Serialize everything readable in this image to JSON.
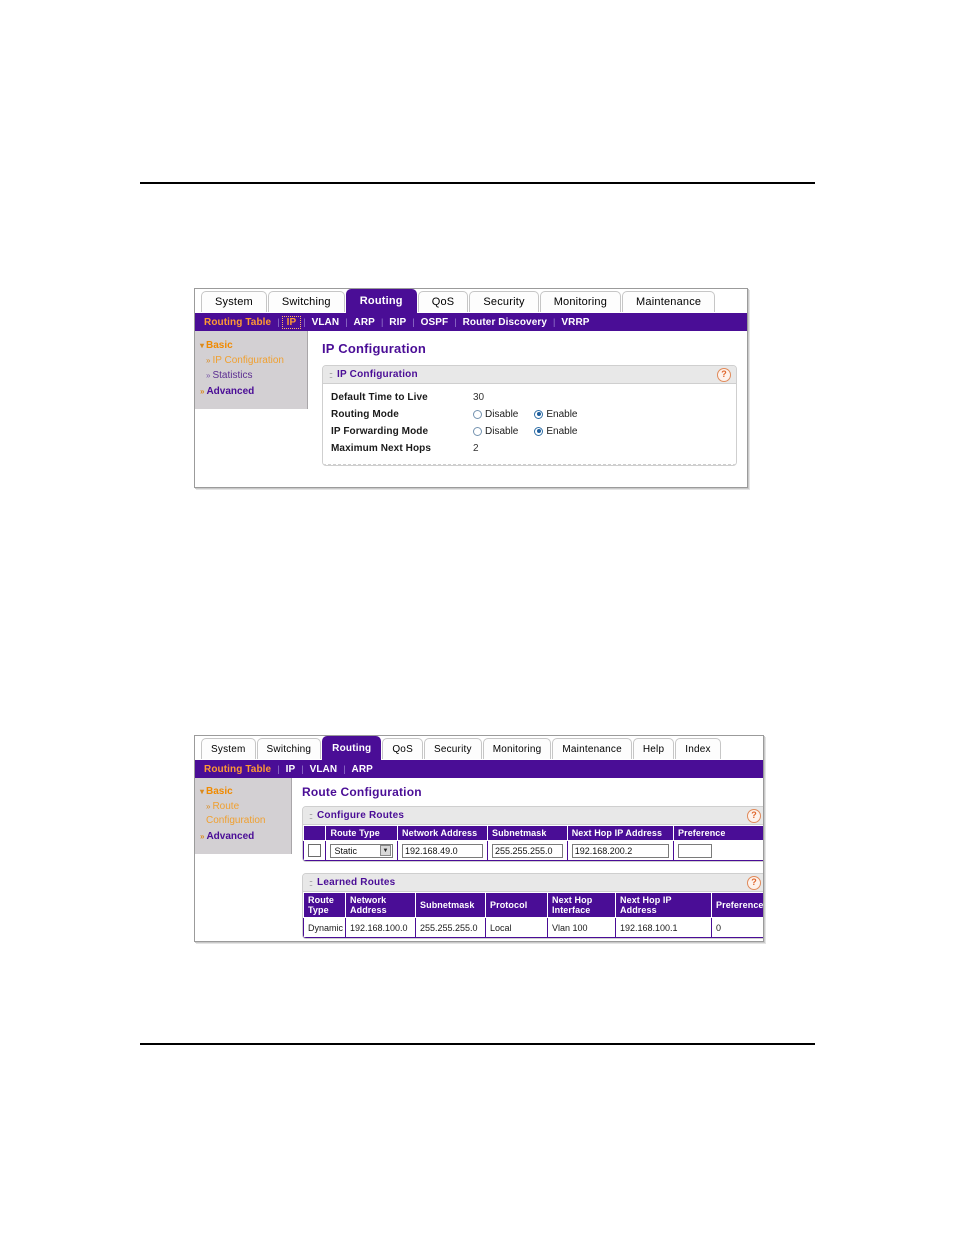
{
  "page": {
    "rules": [
      "top-rule",
      "bottom-rule"
    ]
  },
  "ip_screenshot": {
    "tabs": [
      {
        "label": "System",
        "active": false
      },
      {
        "label": "Switching",
        "active": false
      },
      {
        "label": "Routing",
        "active": true
      },
      {
        "label": "QoS",
        "active": false
      },
      {
        "label": "Security",
        "active": false
      },
      {
        "label": "Monitoring",
        "active": false
      },
      {
        "label": "Maintenance",
        "active": false
      }
    ],
    "subnav": [
      {
        "label": "Routing Table",
        "selected_text": true,
        "boxed": false
      },
      {
        "label": "IP",
        "selected_text": true,
        "boxed": true
      },
      {
        "label": "VLAN",
        "selected_text": false,
        "boxed": false
      },
      {
        "label": "ARP",
        "selected_text": false,
        "boxed": false
      },
      {
        "label": "RIP",
        "selected_text": false,
        "boxed": false
      },
      {
        "label": "OSPF",
        "selected_text": false,
        "boxed": false
      },
      {
        "label": "Router Discovery",
        "selected_text": false,
        "boxed": false
      },
      {
        "label": "VRRP",
        "selected_text": false,
        "boxed": false
      }
    ],
    "sidebar": [
      {
        "label": "Basic",
        "level": 0,
        "selected": false
      },
      {
        "label": "IP Configuration",
        "level": 1,
        "selected": true
      },
      {
        "label": "Statistics",
        "level": 1,
        "selected": false
      },
      {
        "label": "Advanced",
        "level": 0,
        "selected": false
      }
    ],
    "page_title": "IP Configuration",
    "panel": {
      "title": "IP Configuration",
      "help_icon": "help-icon",
      "fields": [
        {
          "label": "Default Time to Live",
          "type": "text",
          "value": "30"
        },
        {
          "label": "Routing Mode",
          "type": "radio",
          "options": [
            "Disable",
            "Enable"
          ],
          "selected": "Enable"
        },
        {
          "label": "IP Forwarding Mode",
          "type": "radio",
          "options": [
            "Disable",
            "Enable"
          ],
          "selected": "Enable"
        },
        {
          "label": "Maximum Next Hops",
          "type": "text",
          "value": "2"
        }
      ]
    }
  },
  "route_screenshot": {
    "tabs": [
      {
        "label": "System",
        "active": false
      },
      {
        "label": "Switching",
        "active": false
      },
      {
        "label": "Routing",
        "active": true
      },
      {
        "label": "QoS",
        "active": false
      },
      {
        "label": "Security",
        "active": false
      },
      {
        "label": "Monitoring",
        "active": false
      },
      {
        "label": "Maintenance",
        "active": false
      },
      {
        "label": "Help",
        "active": false
      },
      {
        "label": "Index",
        "active": false
      }
    ],
    "subnav": [
      {
        "label": "Routing Table",
        "selected_text": true
      },
      {
        "label": "IP",
        "selected_text": false
      },
      {
        "label": "VLAN",
        "selected_text": false
      },
      {
        "label": "ARP",
        "selected_text": false
      }
    ],
    "sidebar": [
      {
        "label": "Basic",
        "level": 0,
        "selected": false
      },
      {
        "label": "Route",
        "level": 1,
        "selected": true
      },
      {
        "label": "Configuration",
        "level": 1,
        "selected": true,
        "continuation": true
      },
      {
        "label": "Advanced",
        "level": 0,
        "selected": false
      }
    ],
    "page_title": "Route Configuration",
    "configure_routes": {
      "title": "Configure Routes",
      "help_icon": "help-icon",
      "columns": [
        "",
        "Route Type",
        "Network Address",
        "Subnetmask",
        "Next Hop IP Address",
        "Preference"
      ],
      "row": {
        "checkbox_checked": false,
        "route_type": "Static",
        "route_type_options": [
          "Static"
        ],
        "network_address": "192.168.49.0",
        "subnetmask": "255.255.255.0",
        "next_hop_ip_address": "192.168.200.2",
        "preference": ""
      }
    },
    "learned_routes": {
      "title": "Learned Routes",
      "help_icon": "help-icon",
      "columns": [
        "Route Type",
        "Network Address",
        "Subnetmask",
        "Protocol",
        "Next Hop Interface",
        "Next Hop IP Address",
        "Preference"
      ],
      "rows": [
        {
          "route_type": "Dynamic",
          "network_address": "192.168.100.0",
          "subnetmask": "255.255.255.0",
          "protocol": "Local",
          "next_hop_interface": "Vlan 100",
          "next_hop_ip_address": "192.168.100.1",
          "preference": "0"
        }
      ]
    }
  },
  "colors": {
    "brand_purple": "#4a0d96",
    "accent_orange": "#f08a00",
    "sidebar_gray": "#d3d0d3",
    "panel_head_gray": "#e8e8e8"
  }
}
